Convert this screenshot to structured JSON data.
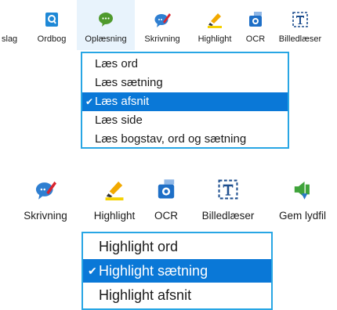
{
  "toolbar1": {
    "items": [
      {
        "label": "slag",
        "icon": "truncated-icon"
      },
      {
        "label": "Ordbog",
        "icon": "dictionary-icon"
      },
      {
        "label": "Oplæsning",
        "icon": "speech-bubble-icon"
      },
      {
        "label": "Skrivning",
        "icon": "writing-bubble-icon"
      },
      {
        "label": "Highlight",
        "icon": "highlighter-icon"
      },
      {
        "label": "OCR",
        "icon": "camera-ocr-icon"
      },
      {
        "label": "Billedlæser",
        "icon": "text-frame-icon"
      }
    ]
  },
  "dropdown1": {
    "items": [
      {
        "label": "Læs ord",
        "checked": false
      },
      {
        "label": "Læs sætning",
        "checked": false
      },
      {
        "label": "Læs afsnit",
        "checked": true
      },
      {
        "label": "Læs side",
        "checked": false
      },
      {
        "label": "Læs bogstav, ord og sætning",
        "checked": false
      }
    ]
  },
  "toolbar2": {
    "items": [
      {
        "label": "Skrivning",
        "icon": "writing-bubble-icon"
      },
      {
        "label": "Highlight",
        "icon": "highlighter-icon"
      },
      {
        "label": "OCR",
        "icon": "camera-ocr-icon"
      },
      {
        "label": "Billedlæser",
        "icon": "text-frame-icon"
      },
      {
        "label": "Gem lydfil",
        "icon": "save-audio-icon"
      }
    ]
  },
  "dropdown2": {
    "items": [
      {
        "label": "Highlight ord",
        "checked": false
      },
      {
        "label": "Highlight sætning",
        "checked": true
      },
      {
        "label": "Highlight afsnit",
        "checked": false
      }
    ]
  },
  "check_glyph": "✔",
  "colors": {
    "accent": "#0a78d7",
    "border": "#28a6e4"
  }
}
